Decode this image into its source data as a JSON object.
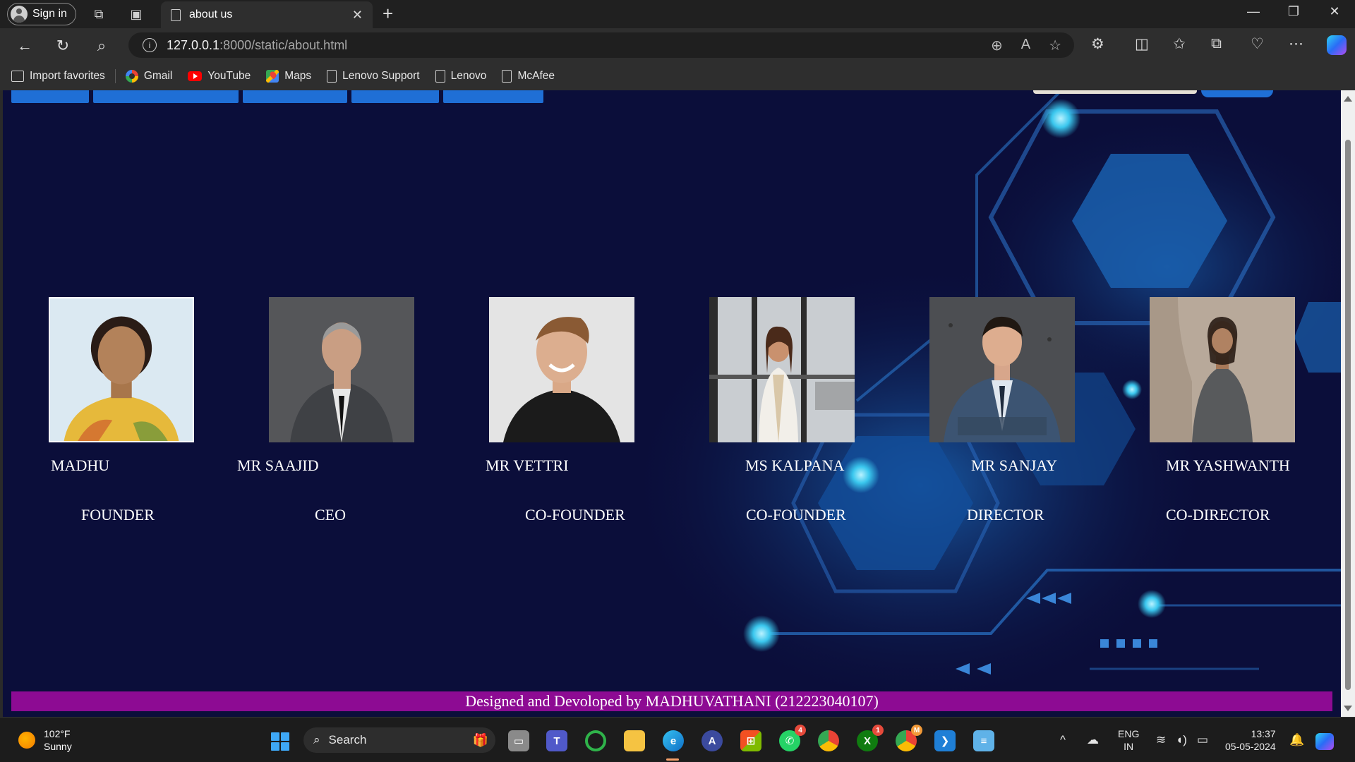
{
  "browser": {
    "sign_in_label": "Sign in",
    "tab_title": "about us",
    "url_host": "127.0.0.1",
    "url_path": ":8000/static/about.html",
    "favorites": [
      {
        "label": "Import favorites",
        "icon": "import-icon"
      },
      {
        "label": "Gmail",
        "icon": "google-icon"
      },
      {
        "label": "YouTube",
        "icon": "youtube-icon"
      },
      {
        "label": "Maps",
        "icon": "maps-icon"
      },
      {
        "label": "Lenovo Support",
        "icon": "page-icon"
      },
      {
        "label": "Lenovo",
        "icon": "page-icon"
      },
      {
        "label": "McAfee",
        "icon": "page-icon"
      }
    ]
  },
  "team": [
    {
      "name": "MADHU",
      "role": "FOUNDER"
    },
    {
      "name": "MR SAAJID",
      "role": "CEO"
    },
    {
      "name": "MR VETTRI",
      "role": "CO-FOUNDER"
    },
    {
      "name": "MS KALPANA",
      "role": "CO-FOUNDER"
    },
    {
      "name": "MR SANJAY",
      "role": "DIRECTOR"
    },
    {
      "name": "MR YASHWANTH",
      "role": "CO-DIRECTOR"
    }
  ],
  "footer": {
    "text": "Designed and Devoloped by MADHUVATHANI (212223040107)"
  },
  "colors": {
    "page_background": "#0b0e3a",
    "footer_background": "#8d0b93",
    "nav_tab": "#1f6fd6"
  },
  "taskbar": {
    "weather_temp": "102°F",
    "weather_desc": "Sunny",
    "search_label": "Search",
    "lang_line1": "ENG",
    "lang_line2": "IN",
    "time": "13:37",
    "date": "05-05-2024",
    "whatsapp_badge": "4",
    "xbox_badge": "1",
    "chrome_profile_badge": "M"
  }
}
